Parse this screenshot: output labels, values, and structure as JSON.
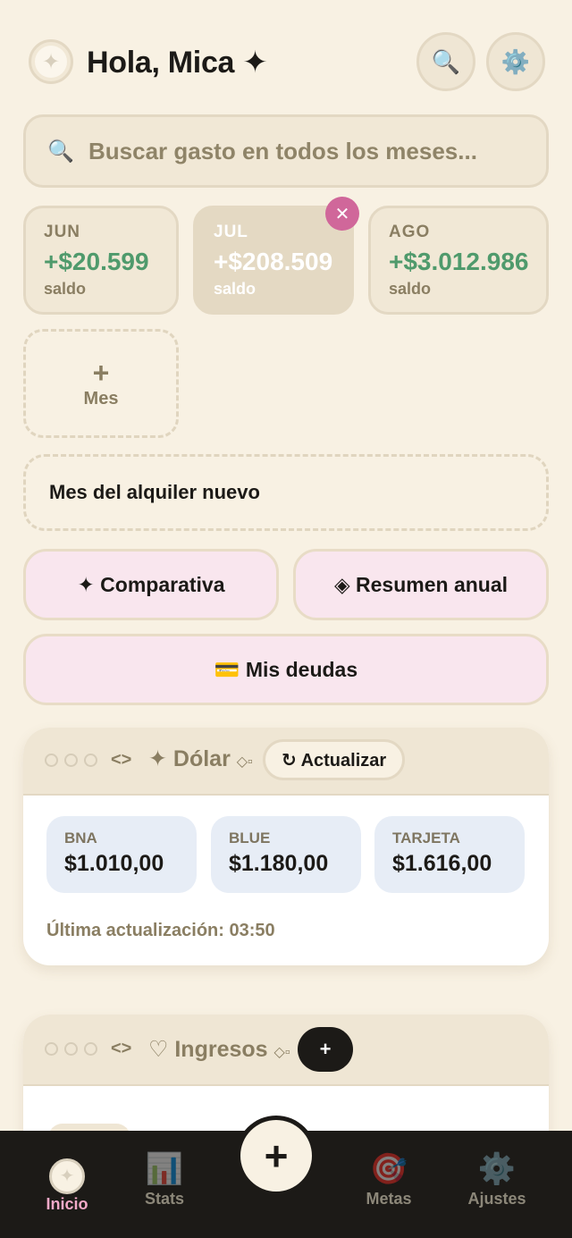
{
  "header": {
    "greeting": "Hola, Mica ✦",
    "logo_icon": "sparkle-logo-icon",
    "search_icon": "🔍",
    "settings_icon": "⚙️"
  },
  "search": {
    "icon": "🔍",
    "placeholder": "Buscar gasto en todos los meses..."
  },
  "months": [
    {
      "name": "JUN",
      "balance": "+$20.599",
      "label": "saldo",
      "active": false
    },
    {
      "name": "JUL",
      "balance": "+$208.509",
      "label": "saldo",
      "active": true
    },
    {
      "name": "AGO",
      "balance": "+$3.012.986",
      "label": "saldo",
      "active": false
    }
  ],
  "remove_month_icon": "✕",
  "add_month": {
    "plus": "+",
    "label": "Mes"
  },
  "month_note": "Mes del alquiler nuevo",
  "actions": {
    "comparativa": "✦ Comparativa",
    "resumen_anual": "◈ Resumen anual",
    "mis_deudas": "💳 Mis deudas"
  },
  "dolar_card": {
    "code_icon": "<>",
    "title": "✦ Dólar",
    "deco": "◇▫",
    "refresh_label": "↻ Actualizar",
    "rates": [
      {
        "name": "BNA",
        "value": "$1.010,00"
      },
      {
        "name": "BLUE",
        "value": "$1.180,00"
      },
      {
        "name": "TARJETA",
        "value": "$1.616,00"
      }
    ],
    "updated": "Última actualización: 03:50"
  },
  "ingresos_card": {
    "code_icon": "<>",
    "title": "♡ Ingresos",
    "deco": "◇▫",
    "add_label": "+"
  },
  "nav": {
    "inicio": "Inicio",
    "stats": "Stats",
    "metas": "Metas",
    "ajustes": "Ajustes",
    "stats_icon": "📊",
    "metas_icon": "🎯",
    "ajustes_icon": "⚙️",
    "fab": "+"
  },
  "colors": {
    "background": "#f8f1e3",
    "positive": "#4f9a6c",
    "accent_pink": "#d0679a",
    "nav_active": "#f3a9c8"
  }
}
